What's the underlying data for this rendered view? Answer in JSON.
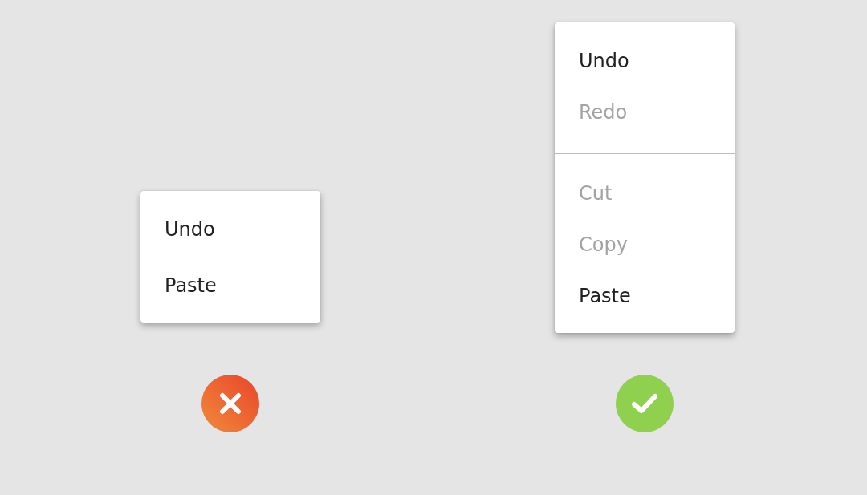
{
  "examples": [
    {
      "correct": false,
      "menu": {
        "groups": [
          {
            "items": [
              {
                "label": "Undo",
                "disabled": false
              },
              {
                "label": "Paste",
                "disabled": false
              }
            ]
          }
        ]
      }
    },
    {
      "correct": true,
      "menu": {
        "groups": [
          {
            "items": [
              {
                "label": "Undo",
                "disabled": false
              },
              {
                "label": "Redo",
                "disabled": true
              }
            ]
          },
          {
            "items": [
              {
                "label": "Cut",
                "disabled": true
              },
              {
                "label": "Copy",
                "disabled": true
              },
              {
                "label": "Paste",
                "disabled": false
              }
            ]
          }
        ]
      }
    }
  ]
}
